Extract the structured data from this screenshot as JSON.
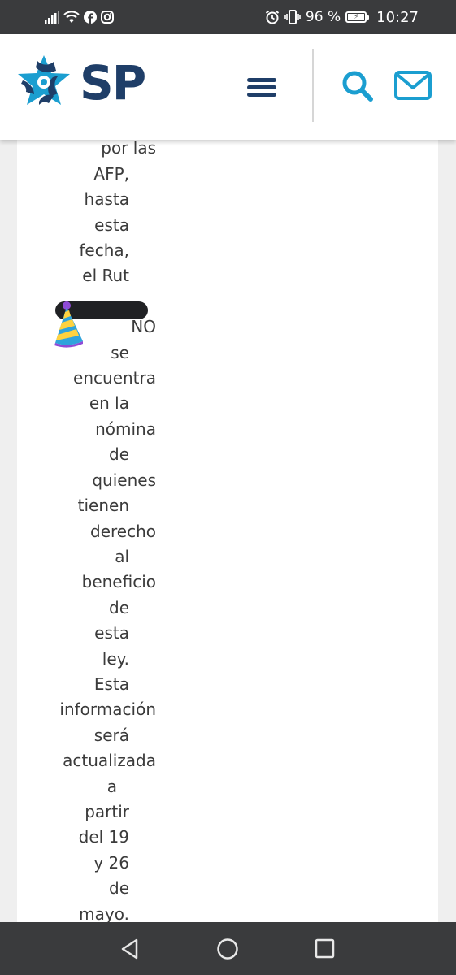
{
  "status_bar": {
    "battery": "96 %",
    "time": "10:27",
    "icons_left": [
      "signal-icon",
      "wifi-icon",
      "facebook-icon",
      "instagram-icon"
    ],
    "icons_right": [
      "alarm-icon",
      "vibrate-icon",
      "battery-icon"
    ]
  },
  "header": {
    "logo_text": "SP",
    "logo_colors": {
      "navy": "#1f3e68",
      "cyan": "#1b9ed0"
    },
    "menu_icon": "hamburger-menu-icon",
    "search_icon": "search-icon",
    "mail_icon": "mail-icon",
    "accent": "#1b9ed0"
  },
  "content": {
    "words": [
      "por las",
      "AFP,",
      "hasta",
      "esta",
      "fecha,",
      "el Rut",
      "",
      "NO",
      "se",
      "encuentra",
      "en la",
      "nómina",
      "de",
      "quienes",
      "tienen",
      "derecho",
      "al",
      "beneficio",
      "de",
      "esta",
      "ley.",
      "Esta",
      "información",
      "será",
      "actualizada",
      "a",
      "partir",
      "del 19",
      "y 26",
      "de",
      "mayo."
    ],
    "emoji": "party-hat-icon"
  },
  "nav_bar": {
    "back_icon": "back-triangle-icon",
    "home_icon": "home-circle-icon",
    "recent_icon": "recent-apps-square-icon"
  }
}
